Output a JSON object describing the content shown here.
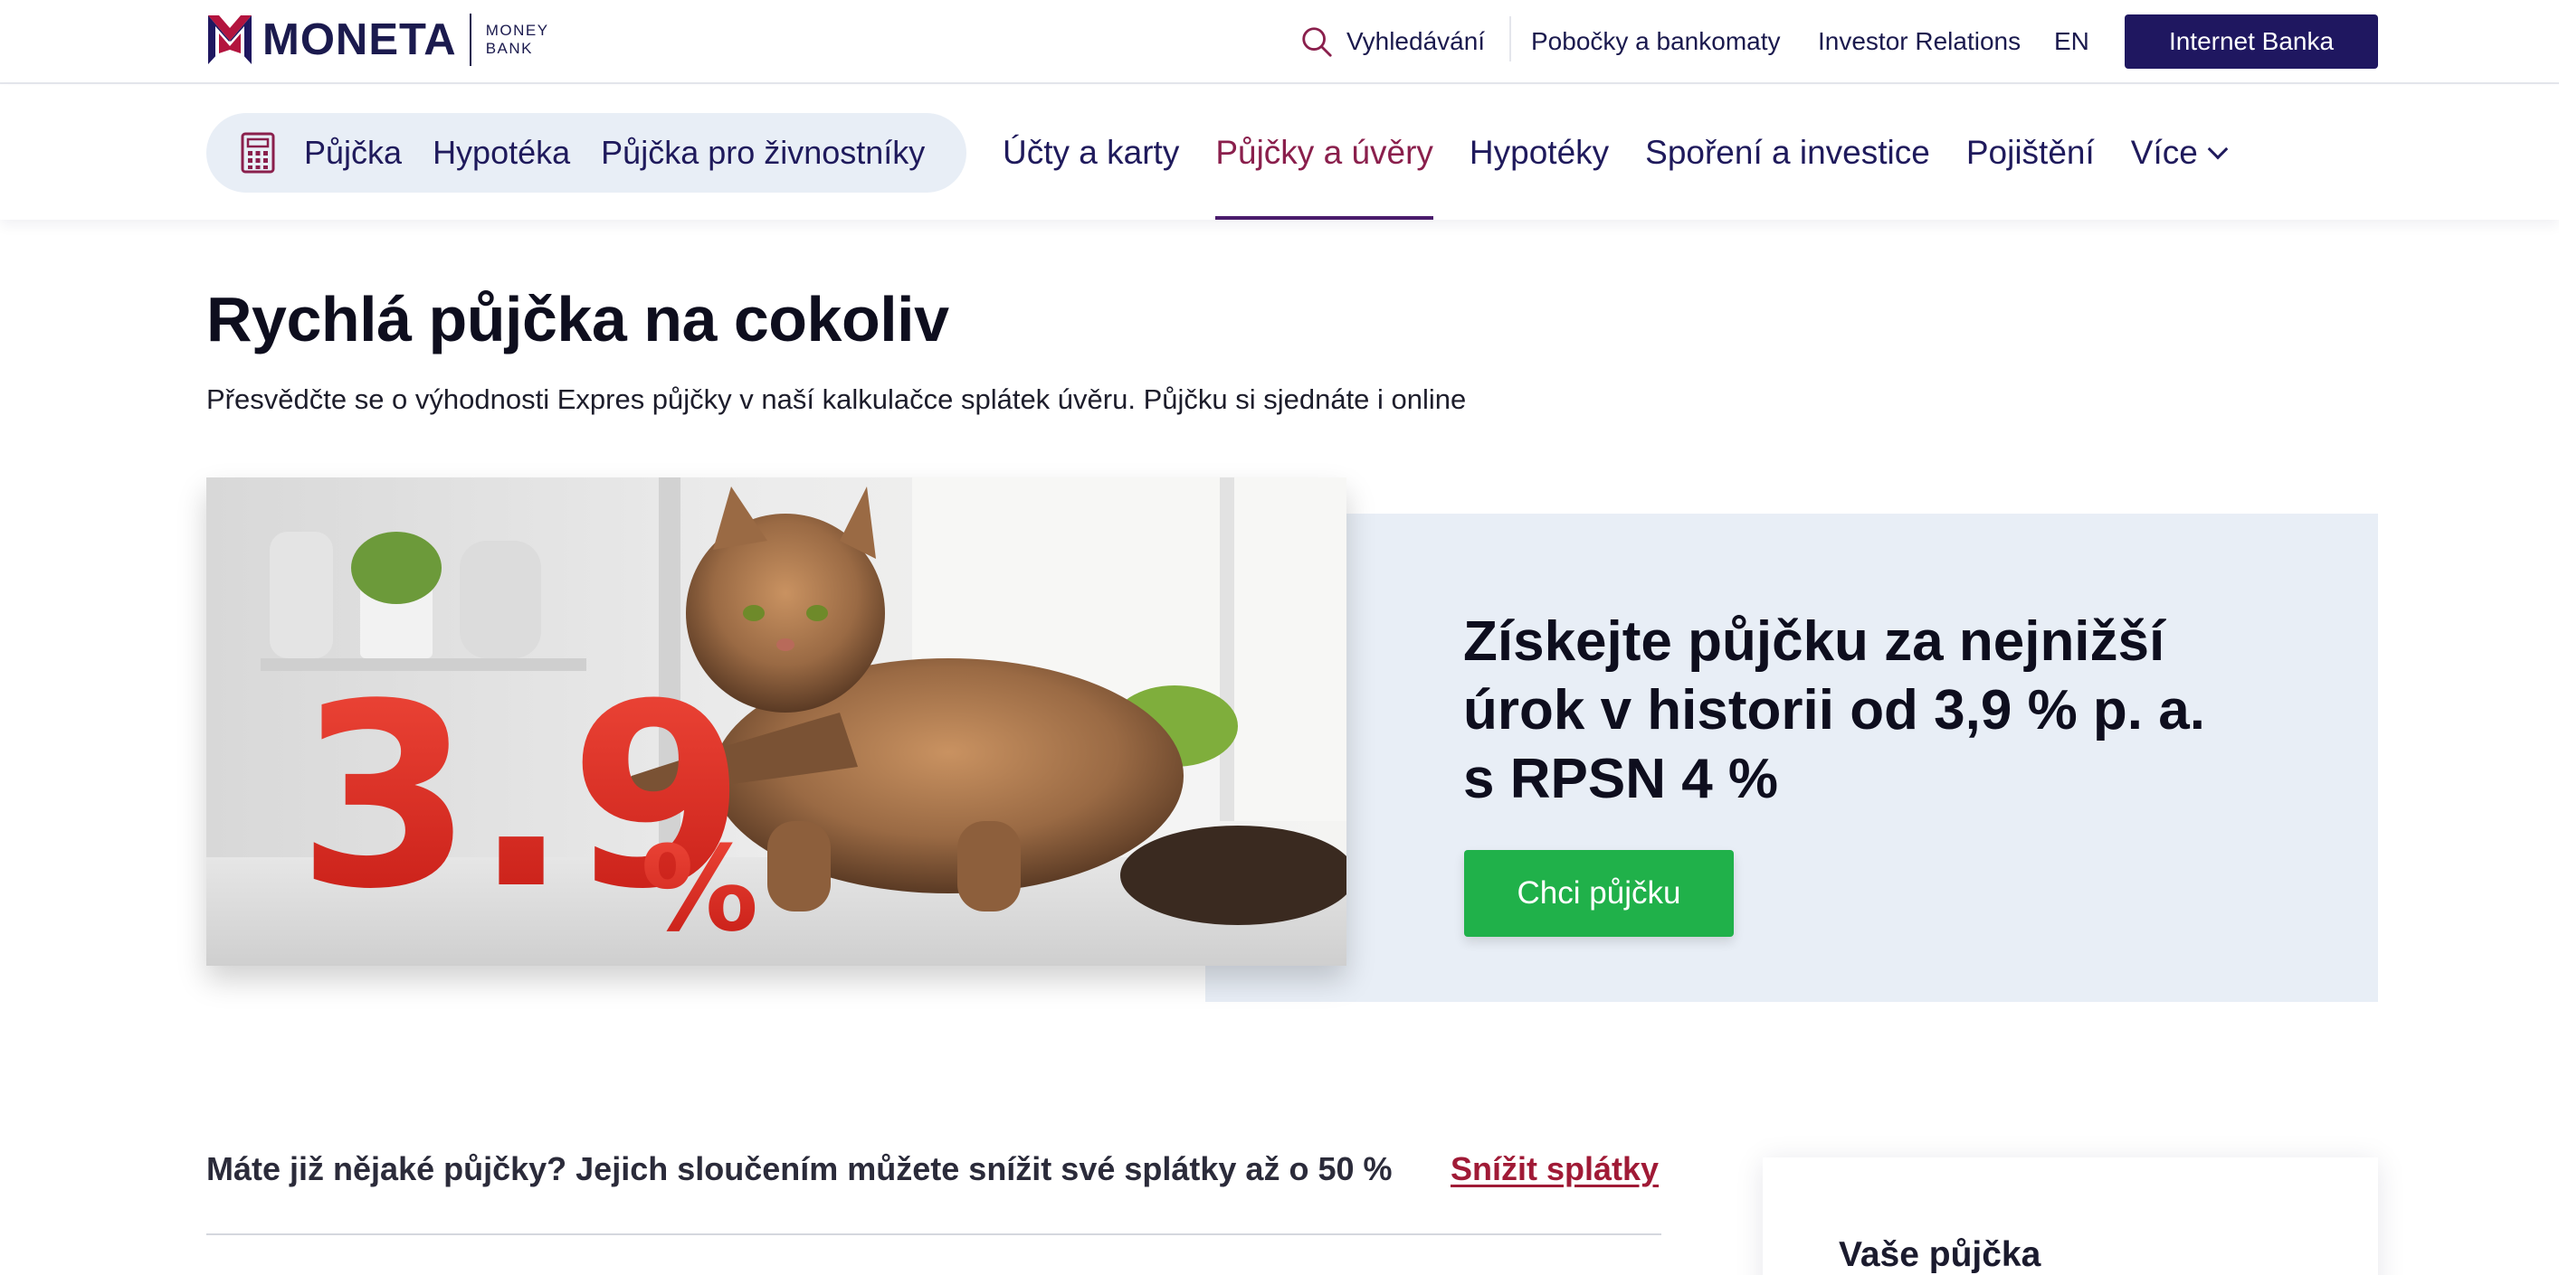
{
  "brand": {
    "logo_name": "MONETA",
    "logo_sub": "MONEY BANK",
    "colors": {
      "navy": "#1f1760",
      "maroon": "#8a1f4c",
      "green": "#20b14a",
      "panel": "#e8eef6",
      "link_red": "#a01a36"
    }
  },
  "utility_nav": {
    "search_label": "Vyhledávání",
    "branches_label": "Pobočky a bankomaty",
    "investor_label": "Investor Relations",
    "language_label": "EN",
    "internet_bank_label": "Internet Banka"
  },
  "quick_links": [
    {
      "label": "Půjčka"
    },
    {
      "label": "Hypotéka"
    },
    {
      "label": "Půjčka pro živnostníky"
    }
  ],
  "main_nav": [
    {
      "label": "Účty a karty",
      "active": false
    },
    {
      "label": "Půjčky a úvěry",
      "active": true
    },
    {
      "label": "Hypotéky",
      "active": false
    },
    {
      "label": "Spoření a investice",
      "active": false
    },
    {
      "label": "Pojištění",
      "active": false
    },
    {
      "label": "Více",
      "active": false
    }
  ],
  "page": {
    "title": "Rychlá půjčka na cokoliv",
    "subtitle": "Přesvědčte se o výhodnosti Expres půjčky v naší kalkulačce splátek úvěru. Půjčku si sjednáte i online"
  },
  "hero": {
    "image_rate_text": "3.9",
    "image_percent": "%",
    "heading_line1": "Získejte půjčku za nejnižší",
    "heading_line2": "úrok v historii od 3,9 % p. a.",
    "heading_line3": "s RPSN 4 %",
    "cta_label": "Chci půjčku"
  },
  "refinance": {
    "text": "Máte již nějaké půjčky? Jejich sloučením můžete snížit své splátky až o 50 %",
    "link_label": "Snížit splátky"
  },
  "loan_card": {
    "title": "Vaše půjčka"
  },
  "icons": [
    "moneta-logo-icon",
    "search-icon",
    "calculator-icon",
    "chevron-down-icon"
  ]
}
